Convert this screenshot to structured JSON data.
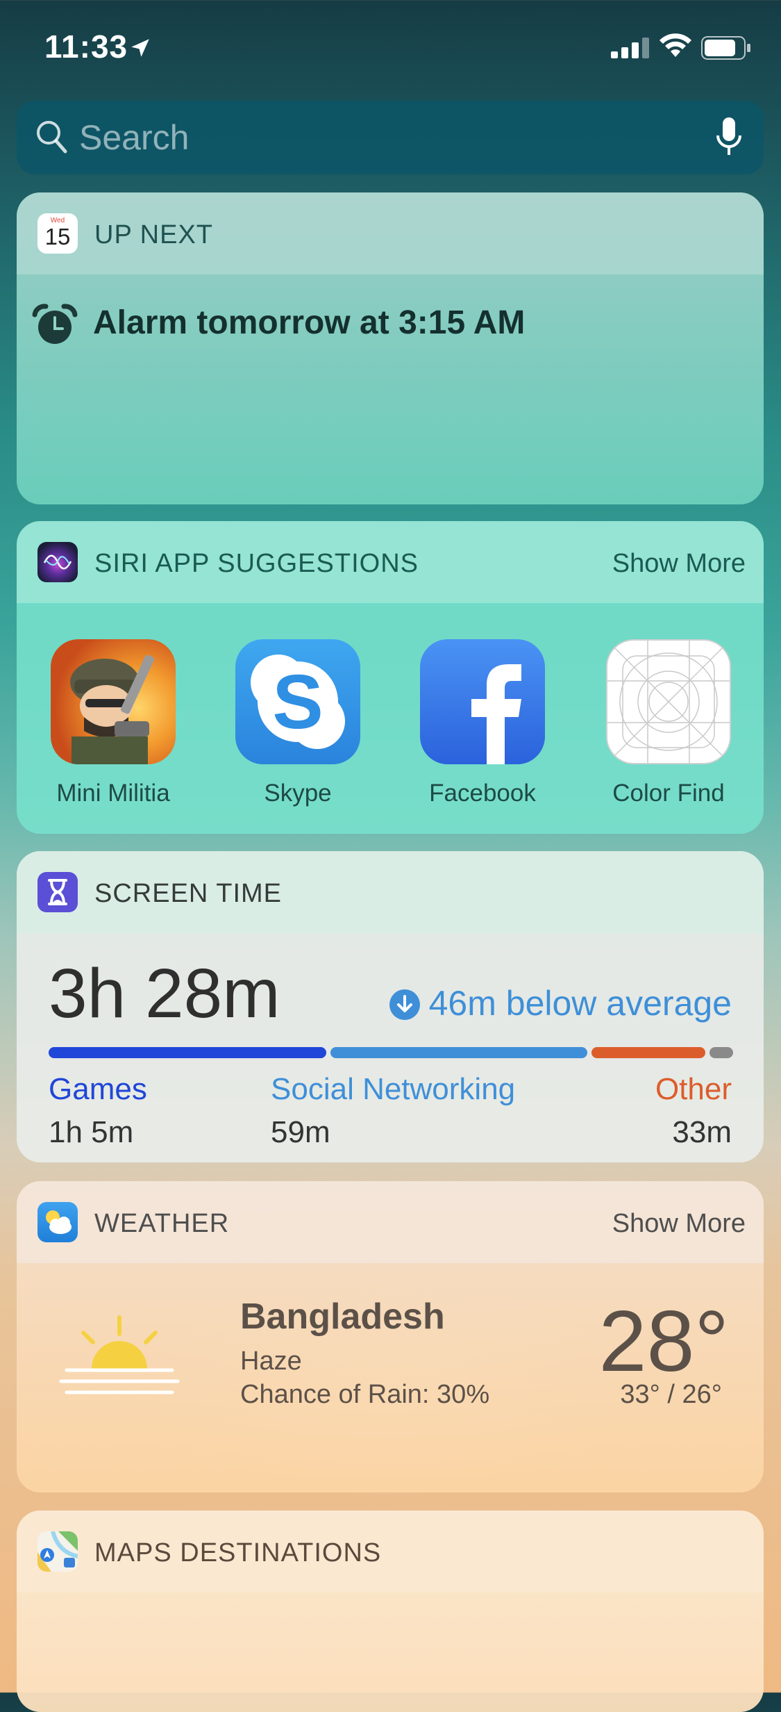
{
  "status_bar": {
    "time": "11:33"
  },
  "search": {
    "placeholder": "Search"
  },
  "up_next": {
    "title": "UP NEXT",
    "calendar_icon": {
      "weekday": "Wed",
      "day": "15"
    },
    "alarm_text": "Alarm tomorrow at 3:15 AM"
  },
  "siri_suggestions": {
    "title": "SIRI APP SUGGESTIONS",
    "show_more": "Show More",
    "apps": [
      {
        "name": "Mini Militia",
        "icon": "mini-militia-icon"
      },
      {
        "name": "Skype",
        "icon": "skype-icon"
      },
      {
        "name": "Facebook",
        "icon": "facebook-icon"
      },
      {
        "name": "Color Find",
        "icon": "color-find-icon"
      }
    ]
  },
  "screen_time": {
    "title": "SCREEN TIME",
    "total": "3h 28m",
    "comparison": "46m below average",
    "categories": [
      {
        "name": "Games",
        "value": "1h 5m",
        "color": "#2046d8"
      },
      {
        "name": "Social Networking",
        "value": "59m",
        "color": "#3f8fd8"
      },
      {
        "name": "Other",
        "value": "33m",
        "color": "#dc5d2c"
      }
    ],
    "remainder_color": "#8a8a8a"
  },
  "weather": {
    "title": "WEATHER",
    "show_more": "Show More",
    "location": "Bangladesh",
    "condition": "Haze",
    "rain_chance": "Chance of Rain: 30%",
    "temperature": "28°",
    "high_low": "33° / 26°"
  },
  "maps": {
    "title": "MAPS DESTINATIONS"
  }
}
